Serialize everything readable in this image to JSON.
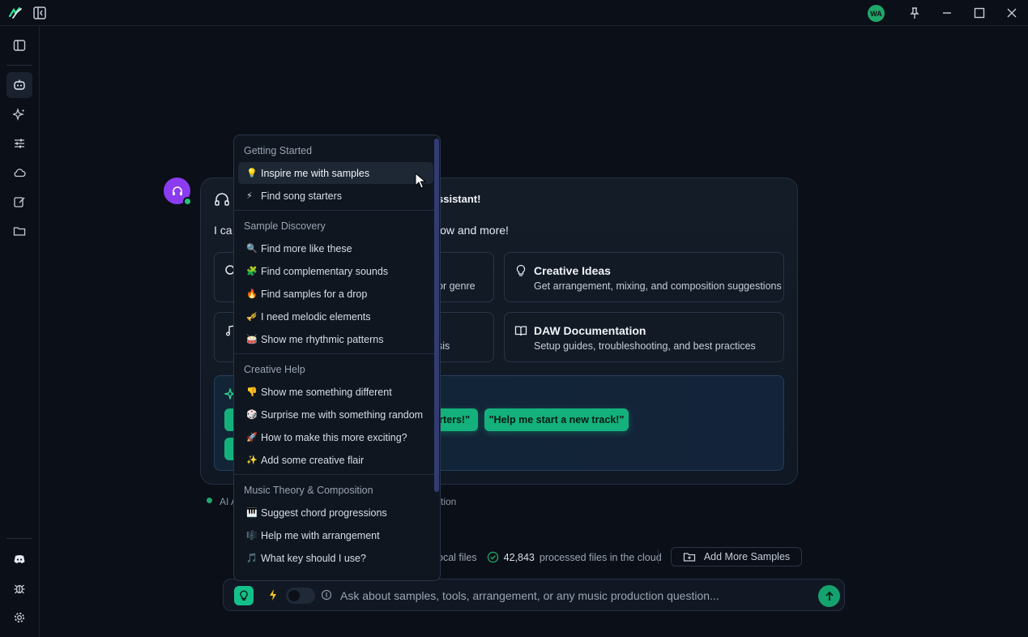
{
  "titlebar": {
    "user_initials": "WA"
  },
  "welcome": {
    "title_partial": "ssistant!",
    "subtitle_partial": "low and more!",
    "intro_partial": "I ca"
  },
  "features": [
    {
      "title": "",
      "description_partial": "or genre",
      "icon": "search-icon"
    },
    {
      "title": "Creative Ideas",
      "description": "Get arrangement, mixing, and composition suggestions",
      "icon": "lightbulb-icon"
    },
    {
      "title": "",
      "description_partial": "sis",
      "icon": "music-note-icon"
    },
    {
      "title": "DAW Documentation",
      "description": "Setup guides, troubleshooting, and best practices",
      "icon": "book-icon"
    }
  ],
  "quick_actions": {
    "btn1_partial": "rters!\"",
    "btn2": "\"Help me start a new track!\""
  },
  "status": {
    "left_partial": "AI A",
    "right_partial": "tion"
  },
  "files": {
    "local_partial": "ocal files",
    "cloud_count": "42,843",
    "cloud_label": "processed files in the cloud",
    "add_more": "Add More Samples"
  },
  "chat": {
    "placeholder": "Ask about samples, tools, arrangement, or any music production question..."
  },
  "dropdown": {
    "sections": [
      {
        "heading": "Getting Started",
        "items": [
          {
            "emoji": "💡",
            "label": "Inspire me with samples"
          },
          {
            "emoji": "⚡",
            "label": "Find song starters"
          }
        ]
      },
      {
        "heading": "Sample Discovery",
        "items": [
          {
            "emoji": "🔍",
            "label": "Find more like these"
          },
          {
            "emoji": "🧩",
            "label": "Find complementary sounds"
          },
          {
            "emoji": "🔥",
            "label": "Find samples for a drop"
          },
          {
            "emoji": "🎺",
            "label": "I need melodic elements"
          },
          {
            "emoji": "🥁",
            "label": "Show me rhythmic patterns"
          }
        ]
      },
      {
        "heading": "Creative Help",
        "items": [
          {
            "emoji": "👎",
            "label": "Show me something different"
          },
          {
            "emoji": "🎲",
            "label": "Surprise me with something random"
          },
          {
            "emoji": "🚀",
            "label": "How to make this more exciting?"
          },
          {
            "emoji": "✨",
            "label": "Add some creative flair"
          }
        ]
      },
      {
        "heading": "Music Theory & Composition",
        "items": [
          {
            "emoji": "🎹",
            "label": "Suggest chord progressions"
          },
          {
            "emoji": "🎼",
            "label": "Help me with arrangement"
          },
          {
            "emoji": "🎵",
            "label": "What key should I use?"
          }
        ]
      }
    ]
  },
  "colors": {
    "accent": "#14b17d",
    "bot_avatar": "#8b3cf0",
    "background": "#0b0f17"
  }
}
